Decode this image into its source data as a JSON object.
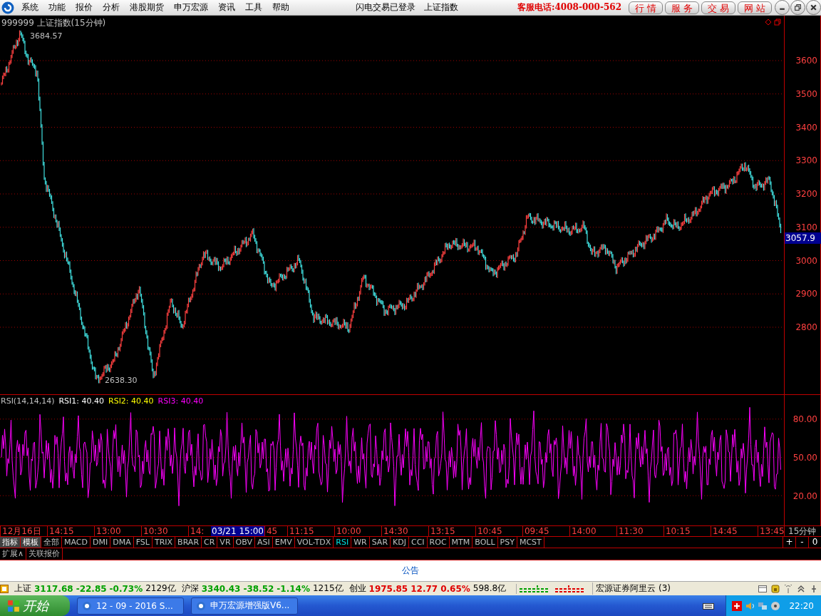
{
  "menu": {
    "items": [
      "系统",
      "功能",
      "报价",
      "分析",
      "港股期货",
      "申万宏源",
      "资讯",
      "工具",
      "帮助"
    ],
    "status": [
      "闪电交易已登录",
      "上证指数"
    ],
    "hotline": "客服电话:4008-000-562",
    "buttons": [
      "行 情",
      "服 务",
      "交 易",
      "网 站"
    ]
  },
  "chart": {
    "title": "999999 上证指数(15分钟)",
    "high_label": "3684.57",
    "low_label": "2638.30",
    "yticks": [
      "3600",
      "3500",
      "3400",
      "3300",
      "3200",
      "3100",
      "3000",
      "2900",
      "2800"
    ],
    "current_price": "3057.9"
  },
  "rsi": {
    "params": "RSI(14,14,14)",
    "lines": [
      {
        "label": "RSI1: 40.40",
        "color": "#ffffff"
      },
      {
        "label": "RSI2: 40.40",
        "color": "#ffff00"
      },
      {
        "label": "RSI3: 40.40",
        "color": "#ff00ff"
      }
    ],
    "yticks": [
      "80.00",
      "50.00",
      "20.00"
    ]
  },
  "time_axis": {
    "labels": [
      {
        "kind": "tick",
        "text": "12月16日"
      },
      {
        "kind": "tick",
        "text": "14:15"
      },
      {
        "kind": "tick",
        "text": "13:00"
      },
      {
        "kind": "tick",
        "text": "10:30"
      },
      {
        "kind": "partial",
        "text": "14:"
      },
      {
        "kind": "cursor",
        "text": "03/21 15:00"
      },
      {
        "kind": "partial",
        "text": "45"
      },
      {
        "kind": "tick",
        "text": "11:15"
      },
      {
        "kind": "tick",
        "text": "10:00"
      },
      {
        "kind": "tick",
        "text": "14:30"
      },
      {
        "kind": "tick",
        "text": "13:15"
      },
      {
        "kind": "tick",
        "text": "10:45"
      },
      {
        "kind": "tick",
        "text": "09:45"
      },
      {
        "kind": "tick",
        "text": "14:00"
      },
      {
        "kind": "tick",
        "text": "11:30"
      },
      {
        "kind": "tick",
        "text": "10:15"
      },
      {
        "kind": "tick",
        "text": "14:45"
      },
      {
        "kind": "tick",
        "text": "13:45"
      }
    ],
    "period": "15分钟"
  },
  "indicator_tabs": [
    {
      "label": "指标",
      "kind": "group",
      "selected": false
    },
    {
      "label": "模板",
      "kind": "group",
      "selected": false
    },
    {
      "label": "全部",
      "kind": "indicator",
      "selected": false
    },
    {
      "label": "MACD",
      "kind": "indicator",
      "selected": false
    },
    {
      "label": "DMI",
      "kind": "indicator",
      "selected": false
    },
    {
      "label": "DMA",
      "kind": "indicator",
      "selected": false
    },
    {
      "label": "FSL",
      "kind": "indicator",
      "selected": false
    },
    {
      "label": "TRIX",
      "kind": "indicator",
      "selected": false
    },
    {
      "label": "BRAR",
      "kind": "indicator",
      "selected": false
    },
    {
      "label": "CR",
      "kind": "indicator",
      "selected": false
    },
    {
      "label": "VR",
      "kind": "indicator",
      "selected": false
    },
    {
      "label": "OBV",
      "kind": "indicator",
      "selected": false
    },
    {
      "label": "ASI",
      "kind": "indicator",
      "selected": false
    },
    {
      "label": "EMV",
      "kind": "indicator",
      "selected": false
    },
    {
      "label": "VOL-TDX",
      "kind": "indicator",
      "selected": false
    },
    {
      "label": "RSI",
      "kind": "indicator",
      "selected": true
    },
    {
      "label": "WR",
      "kind": "indicator",
      "selected": false
    },
    {
      "label": "SAR",
      "kind": "indicator",
      "selected": false
    },
    {
      "label": "KDJ",
      "kind": "indicator",
      "selected": false
    },
    {
      "label": "CCI",
      "kind": "indicator",
      "selected": false
    },
    {
      "label": "ROC",
      "kind": "indicator",
      "selected": false
    },
    {
      "label": "MTM",
      "kind": "indicator",
      "selected": false
    },
    {
      "label": "BOLL",
      "kind": "indicator",
      "selected": false
    },
    {
      "label": "PSY",
      "kind": "indicator",
      "selected": false
    },
    {
      "label": "MCST",
      "kind": "indicator",
      "selected": false
    }
  ],
  "zoom_buttons": [
    "+",
    "-",
    "0"
  ],
  "extra_tabs": [
    "扩展∧",
    "关联报价"
  ],
  "notice": "公告",
  "status_bar": {
    "indices": [
      {
        "name": "上证",
        "value": "3117.68",
        "change": "-22.85",
        "percent": "-0.73%",
        "turnover": "2129亿",
        "color": "#00a000"
      },
      {
        "name": "沪深",
        "value": "3340.43",
        "change": "-38.52",
        "percent": "-1.14%",
        "turnover": "1215亿",
        "color": "#00a000"
      },
      {
        "name": "创业",
        "value": "1975.85",
        "change": "12.77",
        "percent": "0.65%",
        "turnover": "598.8亿",
        "color": "#e00000"
      }
    ],
    "broker": "宏源证券阿里云 (3)"
  },
  "taskbar": {
    "start": "开始",
    "tasks": [
      "12 - 09 - 2016 S...",
      "申万宏源增强版V6..."
    ],
    "clock": "22:20"
  }
}
